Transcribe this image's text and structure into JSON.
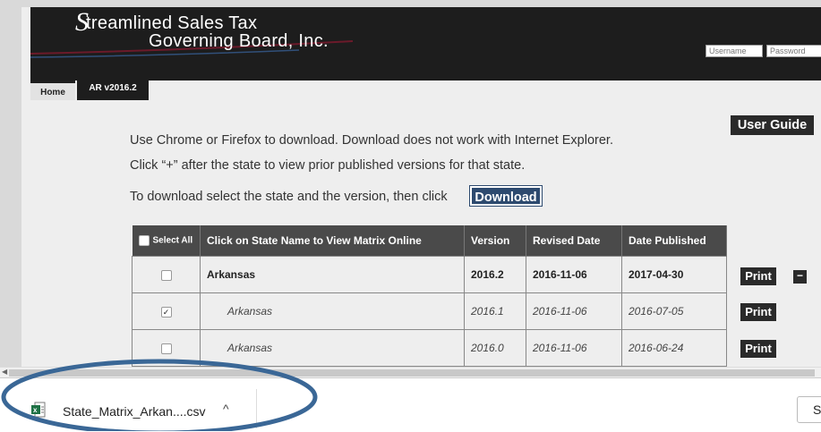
{
  "header": {
    "logo_line1": "treamlined Sales Tax",
    "logo_line1_initial": "S",
    "logo_line2": "Governing Board, Inc.",
    "username_placeholder": "Username",
    "password_placeholder": "Password"
  },
  "tabs": [
    {
      "label": "Home"
    },
    {
      "label": "AR v2016.2"
    }
  ],
  "content": {
    "line1": "Use Chrome or Firefox to download. Download does not work with Internet Explorer.",
    "line2": "Click “+” after the state to view prior published versions for that state.",
    "line3": "To download select the state and the version, then click",
    "download_label": "Download",
    "user_guide_label": "User Guide"
  },
  "table": {
    "headers": [
      "Select All",
      "Click on State Name to View Matrix Online",
      "Version",
      "Revised Date",
      "Date Published"
    ],
    "rows": [
      {
        "checked": false,
        "state": "Arkansas",
        "version": "2016.2",
        "revised": "2016-11-06",
        "published": "2017-04-30",
        "print": "Print",
        "collapse": "−"
      },
      {
        "checked": true,
        "state": "Arkansas",
        "version": "2016.1",
        "revised": "2016-11-06",
        "published": "2016-07-05",
        "print": "Print"
      },
      {
        "checked": false,
        "state": "Arkansas",
        "version": "2016.0",
        "revised": "2016-11-06",
        "published": "2016-06-24",
        "print": "Print"
      }
    ]
  },
  "download_bar": {
    "filename": "State_Matrix_Arkan....csv",
    "chevron": "^",
    "show_all_label": "S"
  },
  "colors": {
    "header_bg": "#1d1d1d",
    "download_btn": "#2d4a6f",
    "annotation_oval": "#3a6796"
  }
}
